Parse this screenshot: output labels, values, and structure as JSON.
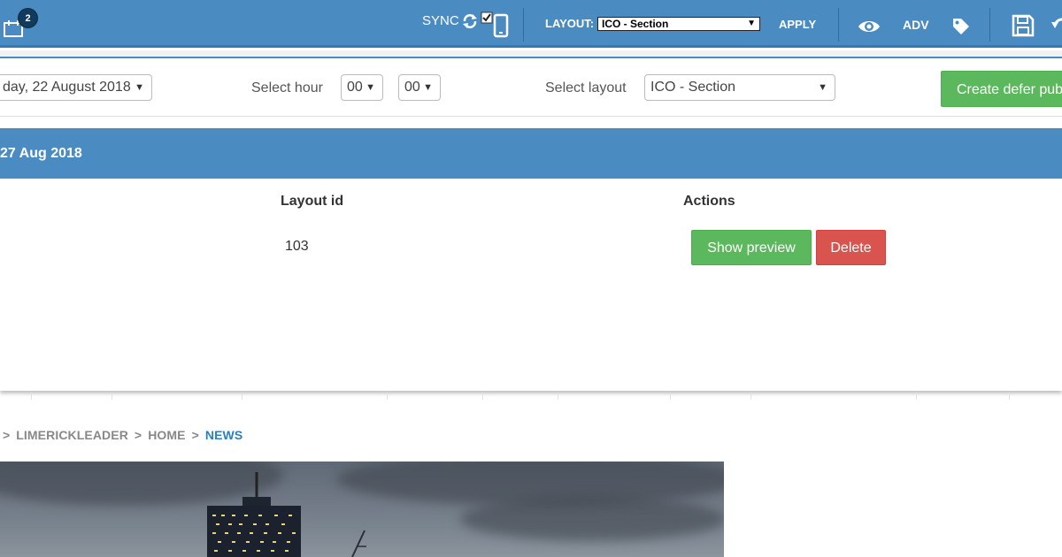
{
  "toolbar": {
    "notification_count": "2",
    "sync_label": "SYNC",
    "layout_label": "LAYOUT:",
    "layout_value": "ICO - Section",
    "apply_label": "APPLY",
    "adv_label": "ADV",
    "icons": [
      "calendar-icon",
      "sync-icon",
      "checkbox-icon",
      "mobile-icon",
      "eye-icon",
      "tag-icon",
      "save-icon",
      "undo-icon"
    ],
    "color": "#4a8cc2"
  },
  "defer": {
    "date_value": "day, 22 August 2018",
    "hour_label": "Select hour",
    "hour_value": "00",
    "minute_value": "00",
    "layout_label": "Select layout",
    "layout_value": "ICO - Section",
    "create_button": "Create defer pub",
    "group_date": "27 Aug 2018",
    "table": {
      "columns": [
        "Layout id",
        "Actions"
      ],
      "rows": [
        {
          "layout_id": "103",
          "preview": "Show preview",
          "delete": "Delete"
        }
      ]
    },
    "colors": {
      "green": "#5cb85c",
      "red": "#d9534f",
      "blue": "#4a8cc2"
    }
  },
  "breadcrumb": {
    "items": [
      "LIMERICKLEADER",
      "HOME",
      "NEWS"
    ],
    "separator": ">"
  }
}
